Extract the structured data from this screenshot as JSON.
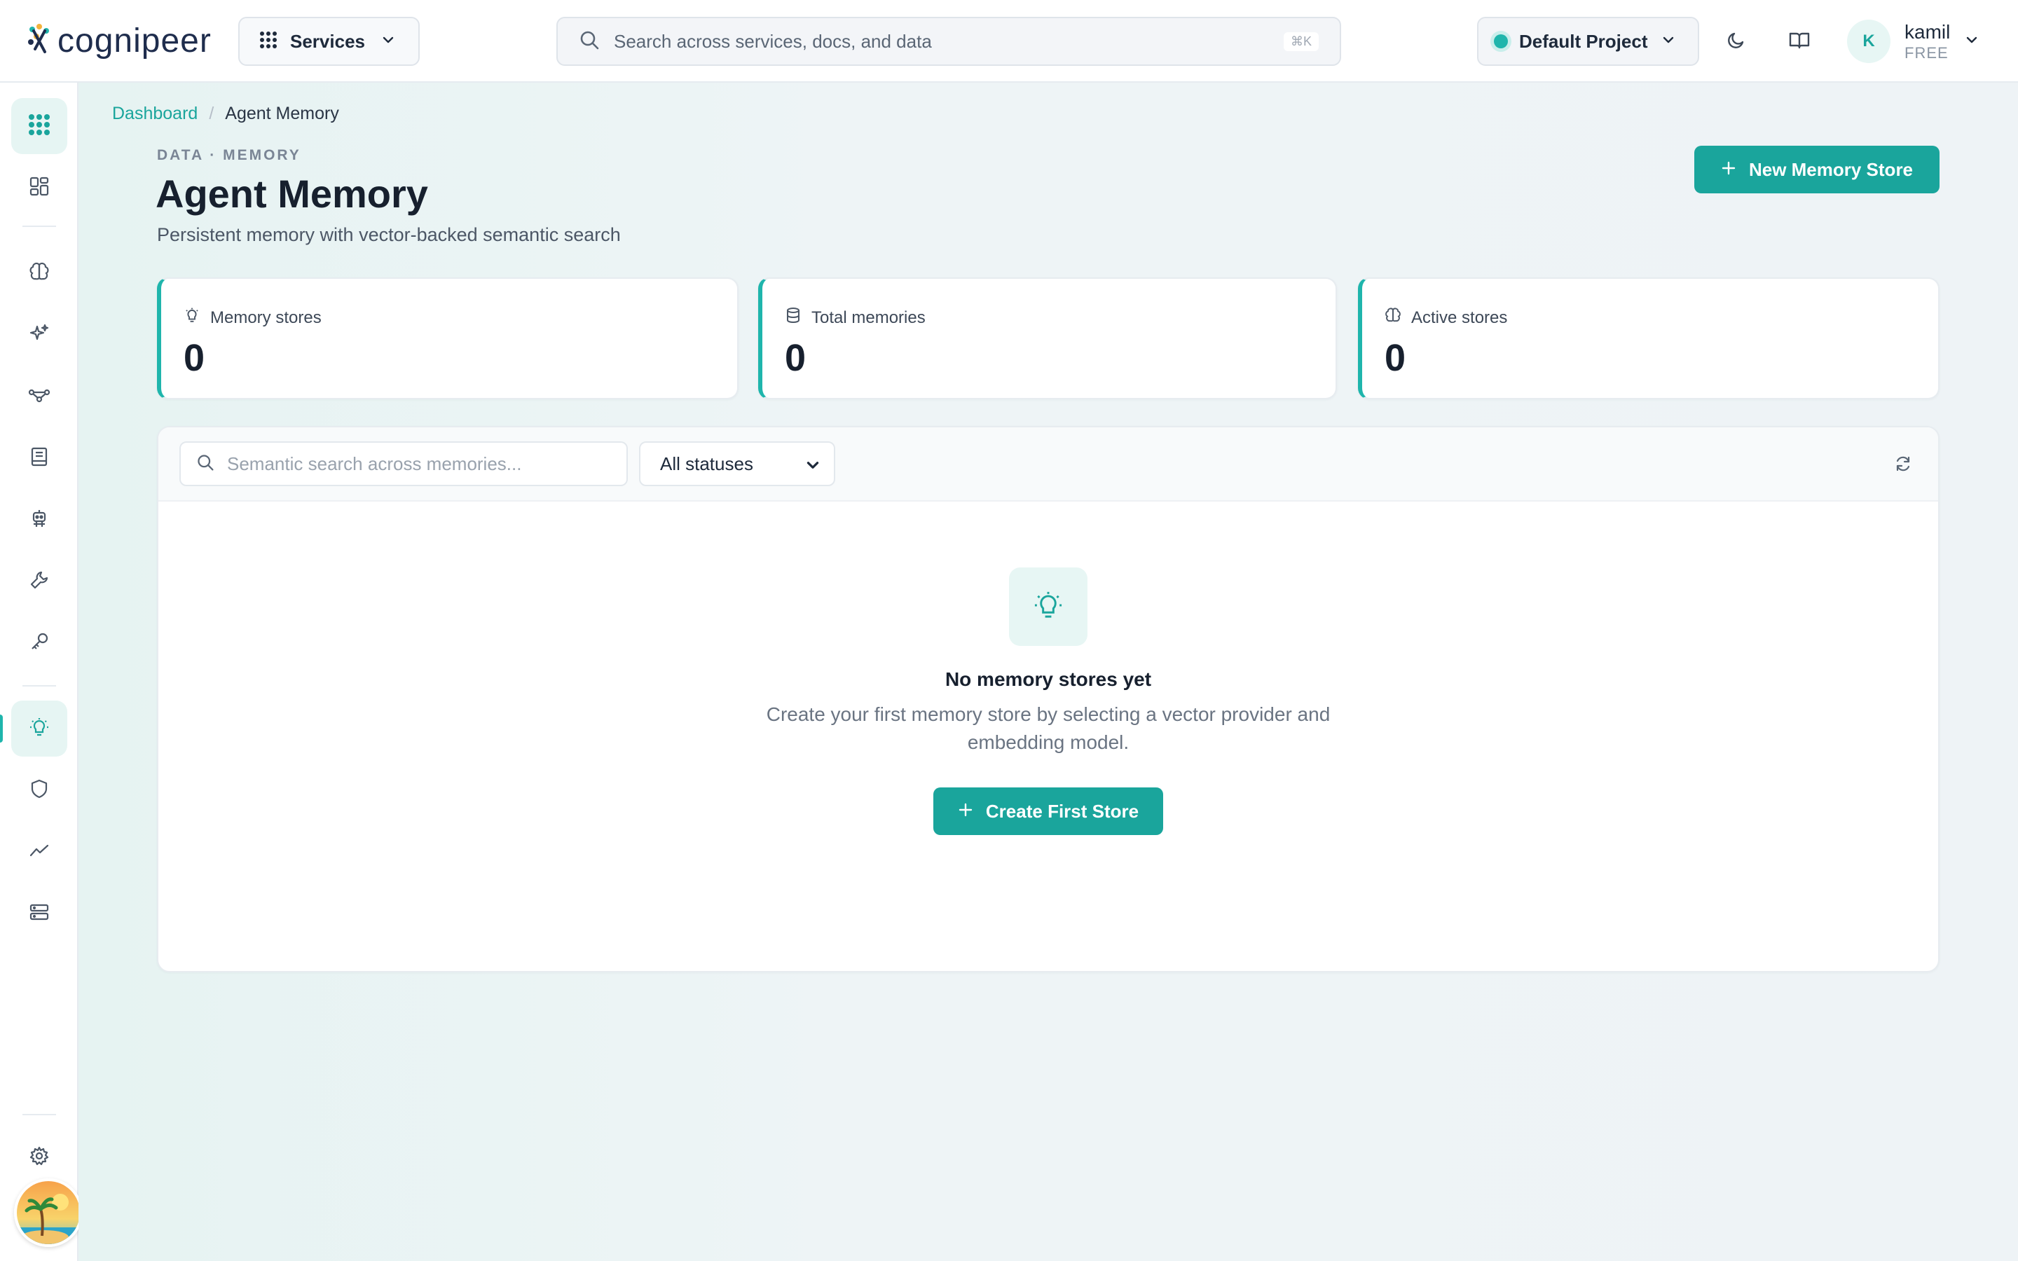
{
  "brand": {
    "name": "cognipeer"
  },
  "topbar": {
    "services_label": "Services",
    "search_placeholder": "Search across services, docs, and data",
    "search_shortcut": "⌘K",
    "project_label": "Default Project",
    "project_status_color": "#1fb5ac",
    "theme_icon": "moon-icon",
    "docs_icon": "book-icon",
    "user": {
      "initial": "K",
      "name": "kamil",
      "plan": "FREE"
    }
  },
  "sidebar": {
    "items": [
      {
        "name": "apps-grid",
        "icon": "grid-dots-icon",
        "active": true
      },
      {
        "name": "dashboard",
        "icon": "dashboard-icon"
      },
      {
        "name": "models",
        "icon": "brain-icon"
      },
      {
        "name": "ai-studio",
        "icon": "sparkles-icon"
      },
      {
        "name": "flows",
        "icon": "flow-icon"
      },
      {
        "name": "knowledge",
        "icon": "document-icon"
      },
      {
        "name": "agents",
        "icon": "robot-icon"
      },
      {
        "name": "tools",
        "icon": "wrench-icon"
      },
      {
        "name": "api-keys",
        "icon": "key-icon"
      },
      {
        "name": "memory",
        "icon": "lightbulb-icon",
        "active": true
      },
      {
        "name": "guardrails",
        "icon": "shield-icon"
      },
      {
        "name": "analytics",
        "icon": "trend-icon"
      },
      {
        "name": "data",
        "icon": "server-icon"
      },
      {
        "name": "settings",
        "icon": "gear-icon"
      }
    ]
  },
  "breadcrumb": {
    "root": "Dashboard",
    "separator": "/",
    "current": "Agent Memory"
  },
  "page": {
    "eyebrow": "DATA · MEMORY",
    "title": "Agent Memory",
    "subtitle": "Persistent memory with vector-backed semantic search",
    "new_button": "New Memory Store"
  },
  "stats": [
    {
      "label": "Memory stores",
      "value": "0",
      "icon": "lightbulb-icon"
    },
    {
      "label": "Total memories",
      "value": "0",
      "icon": "database-icon"
    },
    {
      "label": "Active stores",
      "value": "0",
      "icon": "brain-icon"
    }
  ],
  "filters": {
    "search_placeholder": "Semantic search across memories...",
    "status_selected": "All statuses"
  },
  "empty_state": {
    "title": "No memory stores yet",
    "description": "Create your first memory store by selecting a vector provider and embedding model.",
    "button": "Create First Store"
  },
  "colors": {
    "accent": "#1aa59c",
    "accent_light": "#e7f6f4",
    "text": "#17202e"
  }
}
